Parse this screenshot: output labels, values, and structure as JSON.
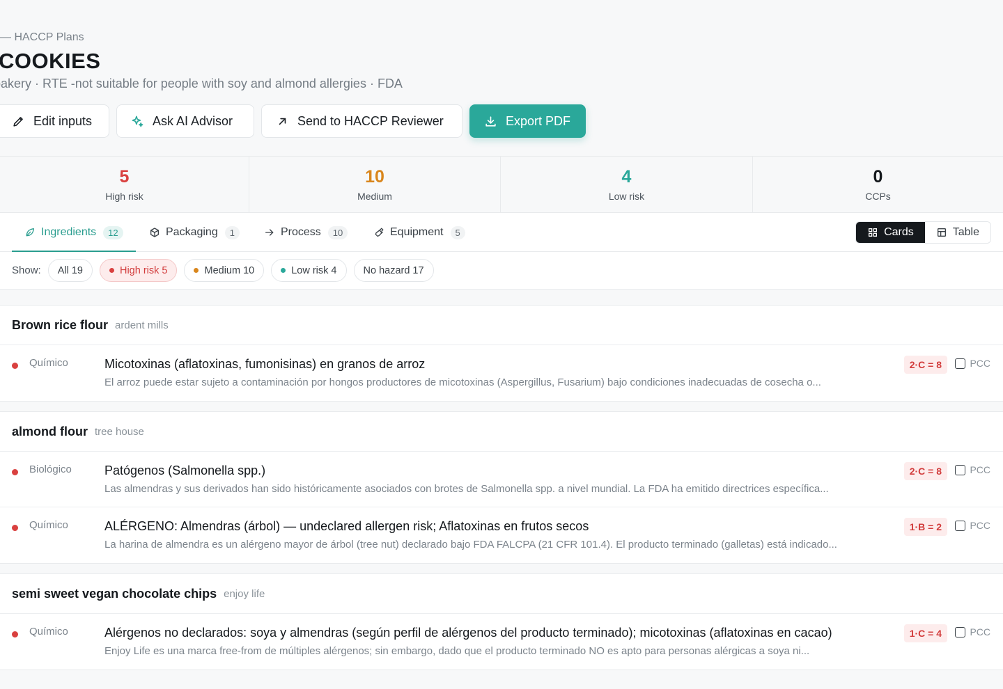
{
  "header": {
    "breadcrumb": "— HACCP Plans",
    "title": "COOKIES",
    "subtitle": "bakery · RTE -not suitable for people with soy and almond allergies · FDA"
  },
  "actions": {
    "edit": "Edit inputs",
    "ai": "Ask AI Advisor",
    "send": "Send to HACCP Reviewer",
    "export": "Export PDF"
  },
  "stats": [
    {
      "value": "5",
      "label": "High risk",
      "color": "#d9403f"
    },
    {
      "value": "10",
      "label": "Medium",
      "color": "#d9861c"
    },
    {
      "value": "4",
      "label": "Low risk",
      "color": "#2aa89a"
    },
    {
      "value": "0",
      "label": "CCPs",
      "color": "#15191d"
    }
  ],
  "tabs": [
    {
      "label": "Ingredients",
      "count": "12",
      "icon": "leaf-icon"
    },
    {
      "label": "Packaging",
      "count": "1",
      "icon": "package-icon"
    },
    {
      "label": "Process",
      "count": "10",
      "icon": "arrow-right-icon"
    },
    {
      "label": "Equipment",
      "count": "5",
      "icon": "wrench-icon"
    }
  ],
  "view_toggle": {
    "cards": "Cards",
    "table": "Table"
  },
  "filters": {
    "show_label": "Show:",
    "chips": [
      {
        "label": "All 19"
      },
      {
        "label": "High risk 5",
        "dot": "#d9403f"
      },
      {
        "label": "Medium 10",
        "dot": "#d9861c"
      },
      {
        "label": "Low risk 4",
        "dot": "#2aa89a"
      },
      {
        "label": "No hazard 17"
      }
    ]
  },
  "groups": [
    {
      "name": "Brown rice flour",
      "supplier": "ardent mills",
      "rows": [
        {
          "type": "Químico",
          "title": "Micotoxinas (aflatoxinas, fumonisinas) en granos de arroz",
          "desc": "El arroz puede estar sujeto a contaminación por hongos productores de micotoxinas (Aspergillus, Fusarium) bajo condiciones inadecuadas de cosecha o...",
          "score": "2·C = 8",
          "pcc": "PCC"
        }
      ]
    },
    {
      "name": "almond flour",
      "supplier": "tree house",
      "rows": [
        {
          "type": "Biológico",
          "title": "Patógenos (Salmonella spp.)",
          "desc": "Las almendras y sus derivados han sido históricamente asociados con brotes de Salmonella spp. a nivel mundial. La FDA ha emitido directrices específica...",
          "score": "2·C = 8",
          "pcc": "PCC"
        },
        {
          "type": "Químico",
          "title": "ALÉRGENO: Almendras (árbol) — undeclared allergen risk; Aflatoxinas en frutos secos",
          "desc": "La harina de almendra es un alérgeno mayor de árbol (tree nut) declarado bajo FDA FALCPA (21 CFR 101.4). El producto terminado (galletas) está indicado...",
          "score": "1·B = 2",
          "pcc": "PCC"
        }
      ]
    },
    {
      "name": "semi sweet vegan chocolate chips",
      "supplier": "enjoy life",
      "rows": [
        {
          "type": "Químico",
          "title": "Alérgenos no declarados: soya y almendras (según perfil de alérgenos del producto terminado); micotoxinas (aflatoxinas en cacao)",
          "desc": "Enjoy Life es una marca free-from de múltiples alérgenos; sin embargo, dado que el producto terminado NO es apto para personas alérgicas a soya ni...",
          "score": "1·C = 4",
          "pcc": "PCC"
        }
      ]
    }
  ]
}
